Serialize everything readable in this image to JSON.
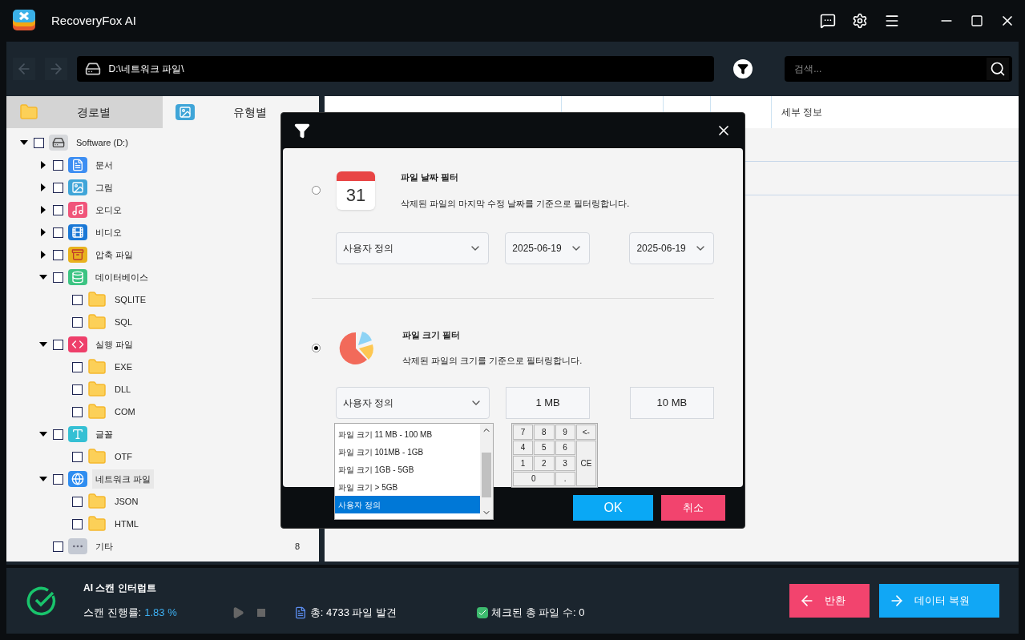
{
  "window": {
    "title": "RecoveryFox AI"
  },
  "toolbar": {
    "path": "D:\\네트워크 파일\\",
    "search": {
      "placeholder": "검색..."
    }
  },
  "view_tabs": [
    {
      "label": "경로별",
      "selected": false,
      "kind": "folder"
    },
    {
      "label": "유형별",
      "selected": true,
      "kind": "image"
    }
  ],
  "tree": [
    {
      "label": "Software (D:)",
      "kind": "drive",
      "checked": false,
      "expanded": true,
      "selected": false,
      "children": [
        {
          "label": "문서",
          "kind": "doc",
          "checked": false,
          "expanded": false,
          "selected": false
        },
        {
          "label": "그림",
          "kind": "image",
          "checked": false,
          "expanded": false,
          "selected": false
        },
        {
          "label": "오디오",
          "kind": "audio",
          "checked": false,
          "expanded": false,
          "selected": false
        },
        {
          "label": "비디오",
          "kind": "video",
          "checked": false,
          "expanded": false,
          "selected": false
        },
        {
          "label": "압축 파일",
          "kind": "archive",
          "checked": false,
          "expanded": false,
          "selected": false
        },
        {
          "label": "데이터베이스",
          "kind": "database",
          "checked": false,
          "expanded": true,
          "selected": false,
          "children": [
            {
              "label": "SQLITE",
              "kind": "folder",
              "checked": false,
              "selected": false
            },
            {
              "label": "SQL",
              "kind": "folder",
              "checked": false,
              "selected": false
            }
          ]
        },
        {
          "label": "실행 파일",
          "kind": "exe",
          "checked": false,
          "expanded": true,
          "selected": false,
          "children": [
            {
              "label": "EXE",
              "kind": "folder",
              "checked": false,
              "selected": false
            },
            {
              "label": "DLL",
              "kind": "folder",
              "checked": false,
              "selected": false
            },
            {
              "label": "COM",
              "kind": "folder",
              "checked": false,
              "selected": false
            }
          ]
        },
        {
          "label": "글꼴",
          "kind": "font",
          "checked": false,
          "expanded": true,
          "selected": false,
          "children": [
            {
              "label": "OTF",
              "kind": "folder",
              "checked": false,
              "selected": false
            }
          ]
        },
        {
          "label": "네트워크 파일",
          "kind": "network",
          "checked": false,
          "expanded": true,
          "selected": true,
          "children": [
            {
              "label": "JSON",
              "kind": "folder",
              "checked": false,
              "selected": false
            },
            {
              "label": "HTML",
              "kind": "folder",
              "checked": false,
              "selected": false
            }
          ]
        },
        {
          "label": "기타",
          "kind": "other",
          "checked": false,
          "selected": false,
          "count": "8"
        }
      ]
    }
  ],
  "table": {
    "columns": [
      "세부 정보"
    ]
  },
  "filter_dialog": {
    "date_filter": {
      "selected": false,
      "title": "파일 날짜 필터",
      "description": "삭제된 파일의 마지막 수정 날짜를 기준으로 필터링합니다.",
      "calendar_day": "31",
      "preset": "사용자 정의",
      "from": "2025-06-19",
      "to": "2025-06-19"
    },
    "size_filter": {
      "selected": true,
      "title": "파일 크기 필터",
      "description": "삭제된 파일의 크기를 기준으로 필터링합니다.",
      "preset": "사용자 정의",
      "from": "1 MB",
      "to": "10 MB"
    },
    "size_options": [
      {
        "label": "파일 크기 11 MB - 100 MB",
        "selected": false
      },
      {
        "label": "파일 크기 101MB - 1GB",
        "selected": false
      },
      {
        "label": "파일 크기 1GB - 5GB",
        "selected": false
      },
      {
        "label": "파일 크기 > 5GB",
        "selected": false
      },
      {
        "label": "사용자 정의",
        "selected": true
      }
    ],
    "keypad": [
      {
        "label": "7",
        "kind": "key"
      },
      {
        "label": "8",
        "kind": "key"
      },
      {
        "label": "9",
        "kind": "key"
      },
      {
        "label": "<-",
        "kind": "key"
      },
      {
        "label": "4",
        "kind": "key"
      },
      {
        "label": "5",
        "kind": "key"
      },
      {
        "label": "6",
        "kind": "key"
      },
      {
        "label": "1",
        "kind": "key"
      },
      {
        "label": "2",
        "kind": "key"
      },
      {
        "label": "3",
        "kind": "key"
      },
      {
        "label": "CE",
        "kind": "tall"
      },
      {
        "label": "0",
        "kind": "wide"
      },
      {
        "label": ".",
        "kind": "key"
      }
    ],
    "ok": "OK",
    "cancel": "취소"
  },
  "status": {
    "title": "AI 스캔 인터럽트",
    "progress_label": "스캔 진행률:",
    "progress_value": "1.83 %",
    "found": "총: 4733 파일 발견",
    "checked_total": {
      "label": "체크된 총 파일 수: 0",
      "checked": true
    },
    "back": "반환",
    "recover": "데이터 복원"
  }
}
